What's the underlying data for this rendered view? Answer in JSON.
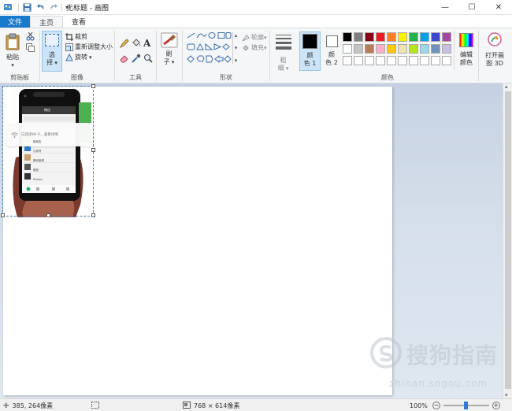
{
  "window": {
    "title": "无标题 - 画图",
    "buttons": {
      "minimize": "—",
      "maximize": "☐",
      "close": "✕"
    }
  },
  "quick_access": {
    "save_icon": "save-icon",
    "undo_icon": "undo-icon",
    "redo_icon": "redo-icon"
  },
  "tabs": [
    {
      "label": "文件"
    },
    {
      "label": "主页"
    },
    {
      "label": "查看"
    }
  ],
  "ribbon": {
    "clipboard": {
      "paste": "粘贴",
      "group": "剪贴板"
    },
    "image": {
      "select_line1": "选",
      "select_line2": "择",
      "crop": "裁剪",
      "resize": "重新调整大小",
      "rotate": "旋转",
      "group": "图像"
    },
    "tools": {
      "group": "工具"
    },
    "brushes": {
      "line1": "刷",
      "line2": "子"
    },
    "shapes": {
      "outline": "轮廓",
      "fill": "填充",
      "group": "形状"
    },
    "size": {
      "line1": "粗",
      "line2": "细"
    },
    "colors": {
      "color1_line1": "颜",
      "color1_line2": "色 1",
      "color2_line1": "颜",
      "color2_line2": "色 2",
      "edit_line1": "编辑",
      "edit_line2": "颜色",
      "group": "颜色",
      "color1": "#000000",
      "color2": "#ffffff",
      "palette_row1": [
        "#000000",
        "#7f7f7f",
        "#880015",
        "#ed1c24",
        "#ff7f27",
        "#fff200",
        "#22b14c",
        "#00a2e8",
        "#3f48cc",
        "#a349a4"
      ],
      "palette_row2": [
        "#ffffff",
        "#c3c3c3",
        "#b97a57",
        "#ffaec9",
        "#ffc90e",
        "#efe4b0",
        "#b5e61d",
        "#99d9ea",
        "#7092be",
        "#c8bfe7"
      ],
      "palette_row3": [
        "#ffffff",
        "#ffffff",
        "#ffffff",
        "#ffffff",
        "#ffffff",
        "#ffffff",
        "#ffffff",
        "#ffffff",
        "#ffffff",
        "#ffffff"
      ]
    },
    "paint3d": {
      "line1": "打开画",
      "line2": "图 3D"
    }
  },
  "pasted_image": {
    "wifi_banner": "已连接Wi-Fi，查看详情",
    "phone_title": "微信",
    "phone_list": [
      "新朋友",
      "订阅号",
      "腾讯新闻",
      "微信",
      "Photos"
    ]
  },
  "status": {
    "cursor": "385, 264像素",
    "size": "768 × 614像素",
    "zoom": "100%"
  },
  "watermark": {
    "text": "搜狗指南",
    "url": "zhinan.sogou.com"
  }
}
